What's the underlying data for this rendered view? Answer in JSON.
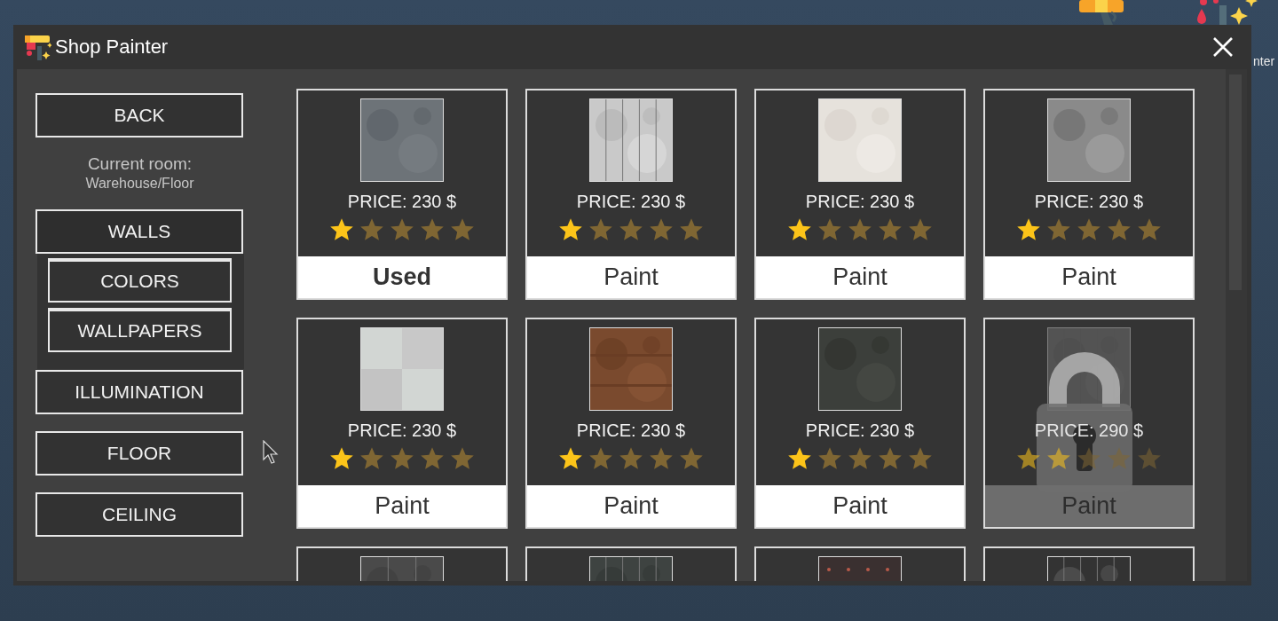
{
  "background_label": "nter",
  "window": {
    "title": "Shop Painter"
  },
  "sidebar": {
    "back": "BACK",
    "current_room_label": "Current room:",
    "current_room": "Warehouse/Floor",
    "menu": [
      {
        "label": "WALLS",
        "expanded": true,
        "children": [
          {
            "label": "COLORS"
          },
          {
            "label": "WALLPAPERS"
          }
        ]
      },
      {
        "label": "ILLUMINATION",
        "expanded": false
      },
      {
        "label": "FLOOR",
        "expanded": false
      },
      {
        "label": "CEILING",
        "expanded": false
      }
    ]
  },
  "cards": [
    {
      "kind": "item",
      "price": "PRICE: 230 $",
      "stars": 1,
      "action": "Used",
      "used": true,
      "locked": false
    },
    {
      "kind": "item",
      "price": "PRICE: 230 $",
      "stars": 1,
      "action": "Paint",
      "used": false,
      "locked": false
    },
    {
      "kind": "item",
      "price": "PRICE: 230 $",
      "stars": 1,
      "action": "Paint",
      "used": false,
      "locked": false
    },
    {
      "kind": "item",
      "price": "PRICE: 230 $",
      "stars": 1,
      "action": "Paint",
      "used": false,
      "locked": false
    },
    {
      "kind": "item",
      "price": "PRICE: 230 $",
      "stars": 1,
      "action": "Paint",
      "used": false,
      "locked": false
    },
    {
      "kind": "item",
      "price": "PRICE: 230 $",
      "stars": 1,
      "action": "Paint",
      "used": false,
      "locked": false
    },
    {
      "kind": "item",
      "price": "PRICE: 230 $",
      "stars": 1,
      "action": "Paint",
      "used": false,
      "locked": false
    },
    {
      "kind": "item",
      "price": "PRICE: 290 $",
      "stars": 2,
      "action": "Paint",
      "used": false,
      "locked": true
    },
    {
      "kind": "partial"
    },
    {
      "kind": "partial"
    },
    {
      "kind": "partial"
    },
    {
      "kind": "partial"
    }
  ]
}
